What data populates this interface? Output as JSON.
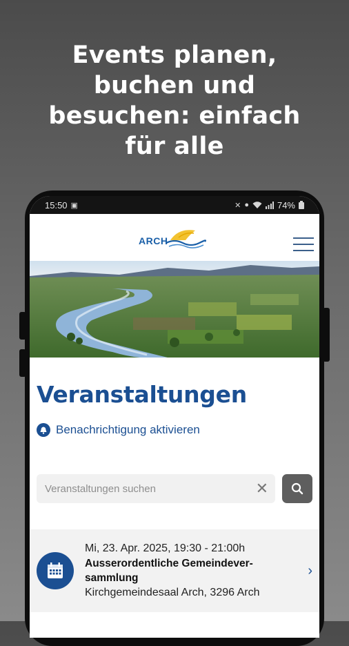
{
  "promo": {
    "line1": "Events planen,",
    "line2": "buchen und",
    "line3": "besuchen: einfach",
    "line4": "für alle"
  },
  "status_bar": {
    "time": "15:50",
    "battery": "74%"
  },
  "header": {
    "logo_text": "ARCH"
  },
  "main": {
    "title": "Veranstaltungen",
    "notify_label": "Benachrichtigung aktivieren",
    "search": {
      "placeholder": "Veranstaltungen suchen",
      "value": ""
    }
  },
  "events": [
    {
      "date": "Mi, 23. Apr. 2025, 19:30 - 21:00h",
      "title_line1": "Ausserordentliche Gemeindever-",
      "title_line2": "sammlung",
      "location": "Kirchgemeindesaal Arch, 3296 Arch"
    }
  ],
  "colors": {
    "brand_blue": "#1b4f92",
    "search_button": "#5e5e5e",
    "event_bg": "#f2f2f2"
  }
}
